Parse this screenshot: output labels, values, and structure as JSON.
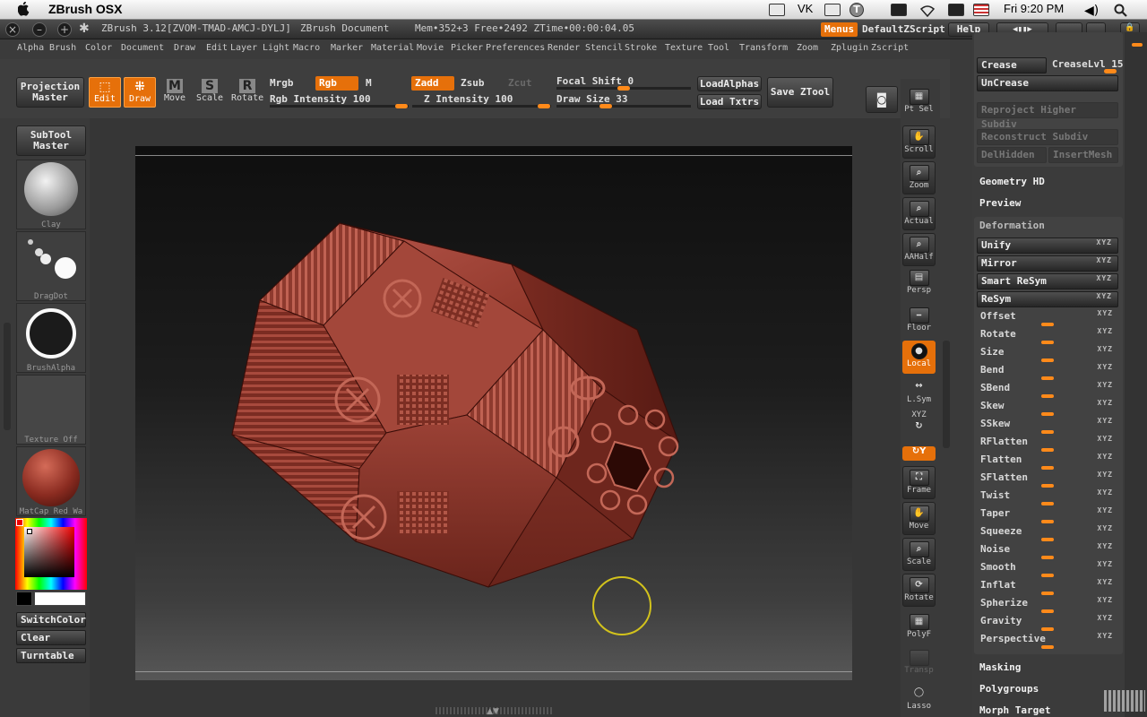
{
  "macbar": {
    "app_name": "ZBrush OSX",
    "vk": "VK",
    "clock": "Fri 9:20 PM"
  },
  "titlebar": {
    "title": "ZBrush 3.12[ZVOM-TMAD-AMCJ-DYLJ]",
    "document": "ZBrush Document",
    "mem": "Mem•352+3 Free•2492 ZTime•00:00:04.05",
    "menus": "Menus",
    "default_zscript": "DefaultZScript",
    "help": "Help"
  },
  "menus": [
    "Alpha",
    "Brush",
    "Color",
    "Document",
    "Draw",
    "Edit",
    "Layer",
    "Light",
    "Macro",
    "Marker",
    "Material",
    "Movie",
    "Picker",
    "Preferences",
    "Render",
    "Stencil",
    "Stroke",
    "Texture",
    "Tool",
    "Transform",
    "Zoom",
    "Zplugin",
    "Zscript"
  ],
  "toolbar": {
    "projection_master": [
      "Projection",
      "Master"
    ],
    "edit": "Edit",
    "draw": "Draw",
    "move": "Move",
    "scale": "Scale",
    "rotate": "Rotate",
    "mrgb": "Mrgb",
    "rgb": "Rgb",
    "m": "M",
    "rgb_intensity": "Rgb Intensity 100",
    "zadd": "Zadd",
    "zsub": "Zsub",
    "zcut": "Zcut",
    "z_intensity": "Z Intensity 100",
    "focal_shift": "Focal Shift 0",
    "draw_size": "Draw Size 33",
    "load_alphas": "LoadAlphas",
    "load_txtrs": "Load Txtrs",
    "save_ztool": "Save ZTool"
  },
  "left": {
    "subtool_master": [
      "SubTool",
      "Master"
    ],
    "thumbs": [
      "Clay",
      "DragDot",
      "BrushAlpha",
      "Texture Off",
      "MatCap Red Wa"
    ],
    "switch_color": "SwitchColor",
    "clear": "Clear",
    "turntable": "Turntable"
  },
  "right_shelf": [
    "Pt Sel",
    "Scroll",
    "Zoom",
    "Actual",
    "AAHalf",
    "Persp",
    "Floor",
    "Local",
    "L.Sym",
    "XYZ",
    "Frame",
    "Move",
    "Scale",
    "Rotate",
    "PolyF",
    "Transp",
    "Lasso"
  ],
  "panel": {
    "crease": "Crease",
    "crease_lvl": "CreaseLvl 15",
    "uncrease": "UnCrease",
    "reproject": "Reproject Higher Subdiv",
    "reconstruct": "Reconstruct Subdiv",
    "delhidden": "DelHidden",
    "insertmesh": "InsertMesh",
    "geometry_hd": "Geometry HD",
    "preview": "Preview",
    "deformation": "Deformation",
    "deform_items": [
      "Unify",
      "Mirror",
      "Smart ReSym",
      "ReSym",
      "Offset",
      "Rotate",
      "Size",
      "Bend",
      "SBend",
      "Skew",
      "SSkew",
      "RFlatten",
      "Flatten",
      "SFlatten",
      "Twist",
      "Taper",
      "Squeeze",
      "Noise",
      "Smooth",
      "Inflat",
      "Spherize",
      "Gravity",
      "Perspective"
    ],
    "deform_axes": [
      "XYZ",
      "XYZ",
      "XYZ",
      "XYZ",
      "XYZ",
      "XYZ",
      "XYZ",
      "XYZ",
      "XYZ",
      "XYZ",
      "XYZ",
      "XYZ",
      "XYZ",
      "XYZ",
      "XYZ",
      "XYZ",
      "XYZ",
      "XYZ",
      "XYZ",
      "XYZ",
      "XYZ",
      "XYZ",
      "XYZ"
    ],
    "masking": "Masking",
    "polygroups": "Polygroups",
    "morph_target": "Morph Target"
  }
}
